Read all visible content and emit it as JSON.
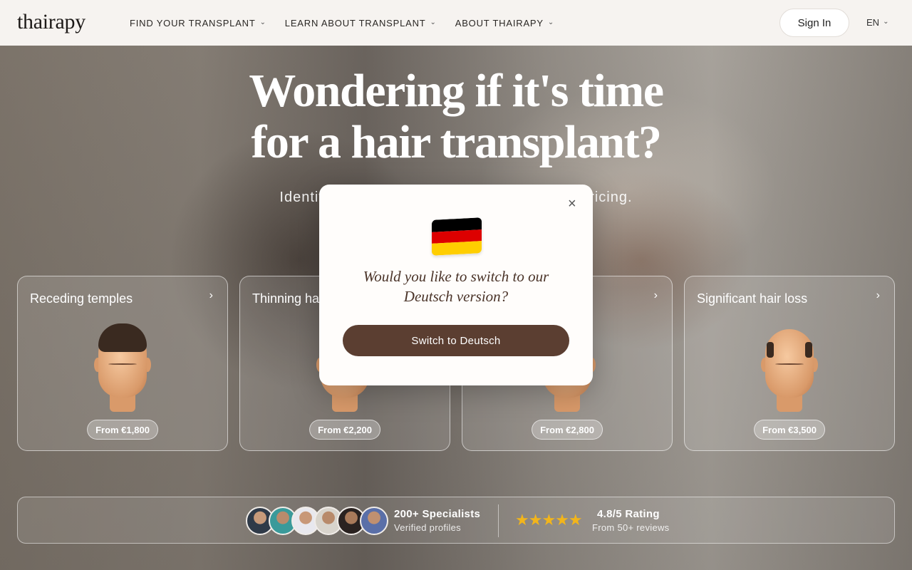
{
  "brand": {
    "logo": "thairapy"
  },
  "nav": {
    "items": [
      {
        "label": "FIND YOUR TRANSPLANT"
      },
      {
        "label": "LEARN ABOUT TRANSPLANT"
      },
      {
        "label": "ABOUT THAIRAPY"
      }
    ],
    "sign_in": "Sign In",
    "language": "EN",
    "chevron_icon": "chevron-down-icon"
  },
  "hero": {
    "headline_line1": "Wondering if it's time",
    "headline_line2": "for a hair transplant?",
    "subline_left": "Identify your s",
    "subline_right": "et real pricing."
  },
  "cards": [
    {
      "title": "Receding temples",
      "price": "From €1,800"
    },
    {
      "title": "Thinning ha",
      "price": "From €2,200"
    },
    {
      "title": "",
      "price": "From €2,800"
    },
    {
      "title": "Significant hair loss",
      "price": "From €3,500"
    }
  ],
  "stats": {
    "specialists_title": "200+ Specialists",
    "specialists_sub": "Verified profiles",
    "stars": "★★★★★",
    "rating_title": "4.8/5 Rating",
    "rating_sub": "From 50+ reviews",
    "star_color": "#f2b51b"
  },
  "modal": {
    "flag": "germany-flag",
    "message": "Would you like to switch to our Deutsch version?",
    "button": "Switch to Deutsch",
    "close": "×",
    "button_color": "#5b3e31",
    "flag_colors": [
      "#000000",
      "#dd0000",
      "#ffce00"
    ]
  }
}
